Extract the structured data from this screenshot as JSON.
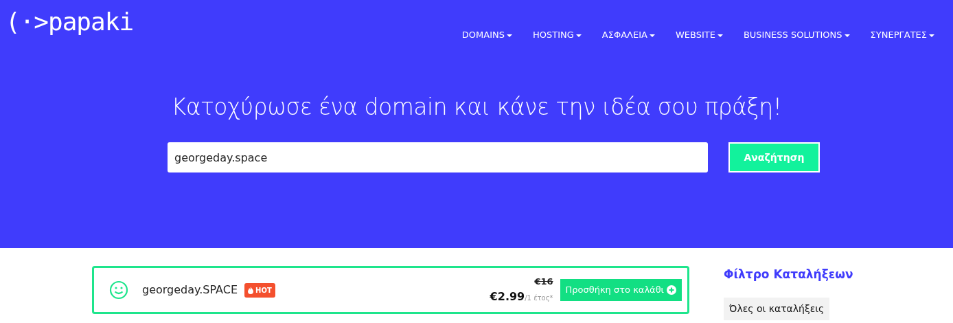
{
  "logo": "(·>papaki",
  "nav": [
    {
      "label": "DOMAINS",
      "dropdown": true
    },
    {
      "label": "HOSTING",
      "dropdown": true
    },
    {
      "label": "ΑΣΦΑΛΕΙΑ",
      "dropdown": true
    },
    {
      "label": "WEBSITE",
      "dropdown": true
    },
    {
      "label": "BUSINESS SOLUTIONS",
      "dropdown": true
    },
    {
      "label": "ΣΥΝΕΡΓΑΤΕΣ",
      "dropdown": true
    }
  ],
  "hero": {
    "title": "Κατοχύρωσε ένα domain και κάνε την ιδέα σου πράξη!",
    "search_value": "georgeday.space",
    "search_button": "Αναζήτηση"
  },
  "results": [
    {
      "available": true,
      "domain": "georgeday.SPACE",
      "badge": "HOT",
      "old_price": "€16",
      "price": "€2.99",
      "period": "/1 έτος*",
      "button": "Προσθήκη στο καλάθι"
    }
  ],
  "sidebar": {
    "title": "Φίλτρο Καταλήξεων",
    "filters": [
      {
        "label": "Όλες οι καταλήξεις",
        "selected": true
      }
    ]
  }
}
